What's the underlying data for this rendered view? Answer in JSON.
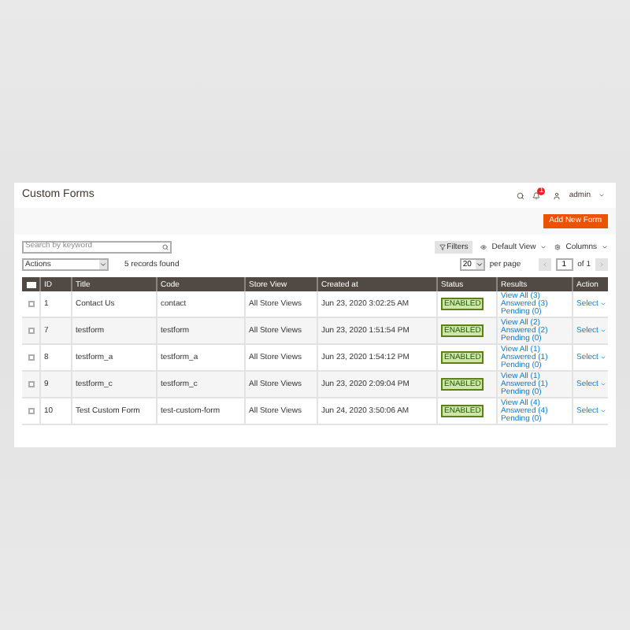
{
  "page": {
    "title": "Custom Forms",
    "user": "admin",
    "notification_count": "1"
  },
  "actions_bar": {
    "add_button": "Add New Form"
  },
  "toolbar": {
    "search": {
      "placeholder": "Search by keyword"
    },
    "mass_actions": "Actions",
    "records": "5 records found",
    "filters": "Filters",
    "view": "Default View",
    "columns": "Columns",
    "per_page_value": "20",
    "per_page_label": "per page",
    "page": "1",
    "page_total": "of 1"
  },
  "table": {
    "select_all": {
      "checked": false
    },
    "columns": [
      "ID",
      "Title",
      "Code",
      "Store View",
      "Created at",
      "Status",
      "Results",
      "Action"
    ],
    "rows": [
      {
        "checked": false,
        "id": "1",
        "title": "Contact Us",
        "code": "contact",
        "store_view": "All Store Views",
        "created_at": "Jun 23, 2020 3:02:25 AM",
        "status": "ENABLED",
        "results": [
          "View All (3)",
          "Answered (3)",
          "Pending (0)"
        ],
        "action": "Select"
      },
      {
        "checked": false,
        "id": "7",
        "title": "testform",
        "code": "testform",
        "store_view": "All Store Views",
        "created_at": "Jun 23, 2020 1:51:54 PM",
        "status": "ENABLED",
        "results": [
          "View All (2)",
          "Answered (2)",
          "Pending (0)"
        ],
        "action": "Select"
      },
      {
        "checked": false,
        "id": "8",
        "title": "testform_a",
        "code": "testform_a",
        "store_view": "All Store Views",
        "created_at": "Jun 23, 2020 1:54:12 PM",
        "status": "ENABLED",
        "results": [
          "View All (1)",
          "Answered (1)",
          "Pending (0)"
        ],
        "action": "Select"
      },
      {
        "checked": false,
        "id": "9",
        "title": "testform_c",
        "code": "testform_c",
        "store_view": "All Store Views",
        "created_at": "Jun 23, 2020 2:09:04 PM",
        "status": "ENABLED",
        "results": [
          "View All (1)",
          "Answered (1)",
          "Pending (0)"
        ],
        "action": "Select"
      },
      {
        "checked": false,
        "id": "10",
        "title": "Test Custom Form",
        "code": "test-custom-form",
        "store_view": "All Store Views",
        "created_at": "Jun 24, 2020 3:50:06 AM",
        "status": "ENABLED",
        "results": [
          "View All (4)",
          "Answered (4)",
          "Pending (0)"
        ],
        "action": "Select"
      }
    ]
  }
}
